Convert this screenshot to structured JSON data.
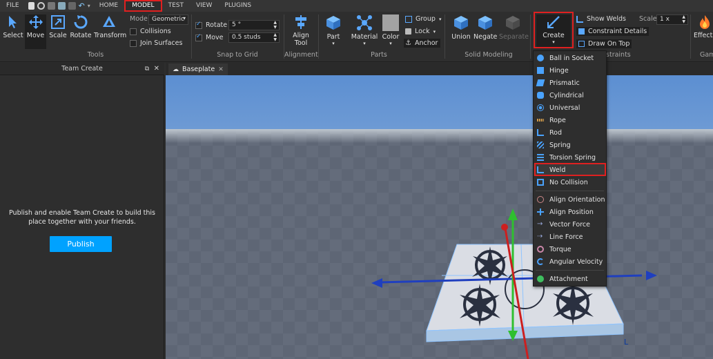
{
  "menubar": {
    "file": "FILE",
    "tabs": [
      {
        "label": "HOME"
      },
      {
        "label": "MODEL"
      },
      {
        "label": "TEST"
      },
      {
        "label": "VIEW"
      },
      {
        "label": "PLUGINS"
      }
    ]
  },
  "tools_group": {
    "label": "Tools",
    "select": "Select",
    "move": "Move",
    "scale": "Scale",
    "rotate": "Rotate",
    "transform": "Transform",
    "mode_label": "Mode:",
    "mode_value": "Geometric",
    "collisions": "Collisions",
    "join_surfaces": "Join Surfaces"
  },
  "snap_group": {
    "label": "Snap to Grid",
    "rotate_label": "Rotate",
    "rotate_value": "5 °",
    "move_label": "Move",
    "move_value": "0.5 studs"
  },
  "alignment_group": {
    "label": "Alignment",
    "align_tool_line1": "Align",
    "align_tool_line2": "Tool"
  },
  "parts_group": {
    "label": "Parts",
    "part": "Part",
    "material": "Material",
    "color": "Color",
    "group": "Group",
    "lock": "Lock",
    "anchor": "Anchor"
  },
  "solid_group": {
    "label": "Solid Modeling",
    "union": "Union",
    "negate": "Negate",
    "separate": "Separate"
  },
  "constraints_group": {
    "label": "nstraints",
    "create": "Create",
    "show_welds": "Show Welds",
    "constraint_details": "Constraint Details",
    "draw_on_top": "Draw On Top",
    "scale_label": "Scale",
    "scale_value": "1 x"
  },
  "effects_group": {
    "effects": "Effects",
    "label": "Gam"
  },
  "panel": {
    "title": "Team Create",
    "message": "Publish and enable Team Create to build this place together with your friends.",
    "publish": "Publish"
  },
  "document_tab": {
    "label": "Baseplate"
  },
  "create_menu": {
    "items": [
      {
        "label": "Ball in Socket",
        "icon": "ball-socket-icon",
        "color": "#4aa3ff"
      },
      {
        "label": "Hinge",
        "icon": "hinge-icon",
        "color": "#4aa3ff"
      },
      {
        "label": "Prismatic",
        "icon": "prismatic-icon",
        "color": "#4aa3ff"
      },
      {
        "label": "Cylindrical",
        "icon": "cylindrical-icon",
        "color": "#4aa3ff"
      },
      {
        "label": "Universal",
        "icon": "universal-icon",
        "color": "#4aa3ff"
      },
      {
        "label": "Rope",
        "icon": "rope-icon",
        "color": "#d09a4a"
      },
      {
        "label": "Rod",
        "icon": "rod-icon",
        "color": "#4aa3ff"
      },
      {
        "label": "Spring",
        "icon": "spring-icon",
        "color": "#4aa3ff"
      },
      {
        "label": "Torsion Spring",
        "icon": "torsion-spring-icon",
        "color": "#4aa3ff"
      },
      {
        "label": "Weld",
        "icon": "weld-icon",
        "color": "#4aa3ff"
      },
      {
        "label": "No Collision",
        "icon": "no-collision-icon",
        "color": "#4aa3ff"
      },
      {
        "label": "Align Orientation",
        "icon": "align-orientation-icon",
        "color": "#c88"
      },
      {
        "label": "Align Position",
        "icon": "align-position-icon",
        "color": "#4aa3ff"
      },
      {
        "label": "Vector Force",
        "icon": "vector-force-icon",
        "color": "#9ad"
      },
      {
        "label": "Line Force",
        "icon": "line-force-icon",
        "color": "#9ad"
      },
      {
        "label": "Torque",
        "icon": "torque-icon",
        "color": "#c8a"
      },
      {
        "label": "Angular Velocity",
        "icon": "angular-velocity-icon",
        "color": "#4aa3ff"
      },
      {
        "label": "Attachment",
        "icon": "attachment-icon",
        "color": "#3fbf5f"
      }
    ]
  },
  "colors": {
    "accent": "#00a2ff",
    "highlight": "#e02020",
    "axis_x": "#1f3fbf",
    "axis_y": "#2fbf2f",
    "axis_z": "#cc1f1f"
  }
}
